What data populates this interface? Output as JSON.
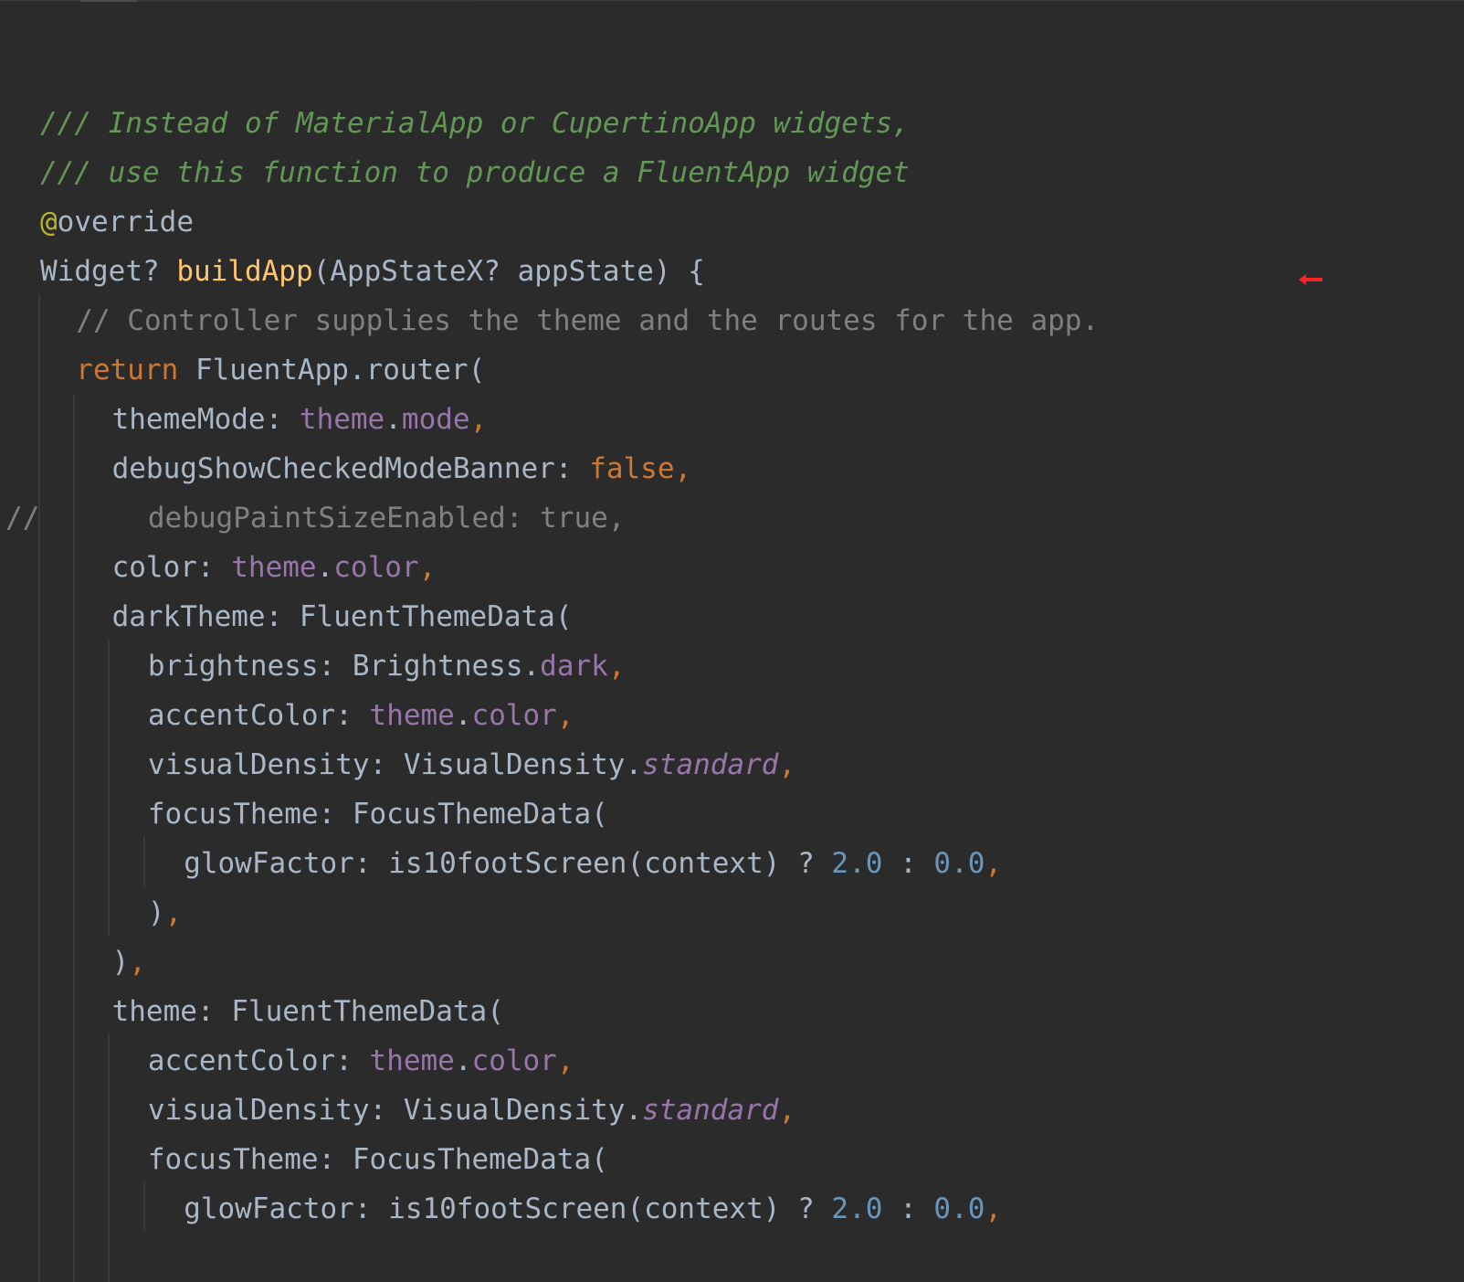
{
  "lines": [
    {
      "marker": "",
      "indent": 0,
      "segments": [
        {
          "text": "/// Instead of MaterialApp or CupertinoApp widgets,",
          "cls": "c-doc"
        }
      ]
    },
    {
      "marker": "",
      "indent": 0,
      "segments": [
        {
          "text": "/// use this function to produce a FluentApp widget",
          "cls": "c-doc"
        }
      ]
    },
    {
      "marker": "",
      "indent": 0,
      "segments": [
        {
          "text": "@",
          "cls": "c-anno"
        },
        {
          "text": "override",
          "cls": "c-default"
        }
      ]
    },
    {
      "marker": "",
      "indent": 0,
      "segments": [
        {
          "text": "Widget? ",
          "cls": "c-default"
        },
        {
          "text": "buildApp",
          "cls": "c-func"
        },
        {
          "text": "(AppStateX? appState) {",
          "cls": "c-default"
        }
      ]
    },
    {
      "marker": "",
      "indent": 1,
      "segments": [
        {
          "text": "// Controller supplies the theme and the routes for the app.",
          "cls": "c-comment"
        }
      ]
    },
    {
      "marker": "",
      "indent": 1,
      "segments": [
        {
          "text": "return ",
          "cls": "c-keyword"
        },
        {
          "text": "FluentApp.router(",
          "cls": "c-default"
        }
      ]
    },
    {
      "marker": "",
      "indent": 2,
      "segments": [
        {
          "text": "themeMode: ",
          "cls": "c-default"
        },
        {
          "text": "theme",
          "cls": "c-field"
        },
        {
          "text": ".",
          "cls": "c-default"
        },
        {
          "text": "mode",
          "cls": "c-field"
        },
        {
          "text": ",",
          "cls": "c-comma"
        }
      ]
    },
    {
      "marker": "",
      "indent": 2,
      "segments": [
        {
          "text": "debugShowCheckedModeBanner: ",
          "cls": "c-default"
        },
        {
          "text": "false",
          "cls": "c-keyword"
        },
        {
          "text": ",",
          "cls": "c-comma"
        }
      ]
    },
    {
      "marker": "//",
      "indent": 3,
      "segments": [
        {
          "text": "debugPaintSizeEnabled: true,",
          "cls": "c-muted"
        }
      ]
    },
    {
      "marker": "",
      "indent": 2,
      "segments": [
        {
          "text": "color: ",
          "cls": "c-default"
        },
        {
          "text": "theme",
          "cls": "c-field"
        },
        {
          "text": ".",
          "cls": "c-default"
        },
        {
          "text": "color",
          "cls": "c-field"
        },
        {
          "text": ",",
          "cls": "c-comma"
        }
      ]
    },
    {
      "marker": "",
      "indent": 2,
      "segments": [
        {
          "text": "darkTheme: FluentThemeData(",
          "cls": "c-default"
        }
      ]
    },
    {
      "marker": "",
      "indent": 3,
      "segments": [
        {
          "text": "brightness: Brightness.",
          "cls": "c-default"
        },
        {
          "text": "dark",
          "cls": "c-field"
        },
        {
          "text": ",",
          "cls": "c-comma"
        }
      ]
    },
    {
      "marker": "",
      "indent": 3,
      "segments": [
        {
          "text": "accentColor: ",
          "cls": "c-default"
        },
        {
          "text": "theme",
          "cls": "c-field"
        },
        {
          "text": ".",
          "cls": "c-default"
        },
        {
          "text": "color",
          "cls": "c-field"
        },
        {
          "text": ",",
          "cls": "c-comma"
        }
      ]
    },
    {
      "marker": "",
      "indent": 3,
      "segments": [
        {
          "text": "visualDensity: VisualDensity.",
          "cls": "c-default"
        },
        {
          "text": "standard",
          "cls": "c-static"
        },
        {
          "text": ",",
          "cls": "c-comma"
        }
      ]
    },
    {
      "marker": "",
      "indent": 3,
      "segments": [
        {
          "text": "focusTheme: FocusThemeData(",
          "cls": "c-default"
        }
      ]
    },
    {
      "marker": "",
      "indent": 4,
      "segments": [
        {
          "text": "glowFactor: is10footScreen(context) ? ",
          "cls": "c-default"
        },
        {
          "text": "2.0",
          "cls": "c-number"
        },
        {
          "text": " : ",
          "cls": "c-default"
        },
        {
          "text": "0.0",
          "cls": "c-number"
        },
        {
          "text": ",",
          "cls": "c-comma"
        }
      ]
    },
    {
      "marker": "",
      "indent": 3,
      "segments": [
        {
          "text": ")",
          "cls": "c-default"
        },
        {
          "text": ",",
          "cls": "c-comma"
        }
      ]
    },
    {
      "marker": "",
      "indent": 2,
      "segments": [
        {
          "text": ")",
          "cls": "c-default"
        },
        {
          "text": ",",
          "cls": "c-comma"
        }
      ]
    },
    {
      "marker": "",
      "indent": 2,
      "segments": [
        {
          "text": "theme: FluentThemeData(",
          "cls": "c-default"
        }
      ]
    },
    {
      "marker": "",
      "indent": 3,
      "segments": [
        {
          "text": "accentColor: ",
          "cls": "c-default"
        },
        {
          "text": "theme",
          "cls": "c-field"
        },
        {
          "text": ".",
          "cls": "c-default"
        },
        {
          "text": "color",
          "cls": "c-field"
        },
        {
          "text": ",",
          "cls": "c-comma"
        }
      ]
    },
    {
      "marker": "",
      "indent": 3,
      "segments": [
        {
          "text": "visualDensity: VisualDensity.",
          "cls": "c-default"
        },
        {
          "text": "standard",
          "cls": "c-static"
        },
        {
          "text": ",",
          "cls": "c-comma"
        }
      ]
    },
    {
      "marker": "",
      "indent": 3,
      "segments": [
        {
          "text": "focusTheme: FocusThemeData(",
          "cls": "c-default"
        }
      ]
    },
    {
      "marker": "",
      "indent": 4,
      "segments": [
        {
          "text": "glowFactor: is10footScreen(context) ? ",
          "cls": "c-default"
        },
        {
          "text": "2.0",
          "cls": "c-number"
        },
        {
          "text": " : ",
          "cls": "c-default"
        },
        {
          "text": "0.0",
          "cls": "c-number"
        },
        {
          "text": ",",
          "cls": "c-comma"
        }
      ]
    }
  ],
  "colors": {
    "background": "#2b2b2b",
    "doc_comment": "#629755",
    "comment": "#808080",
    "annotation": "#bbb529",
    "default": "#a9b7c6",
    "function": "#ffc66d",
    "keyword": "#cc7832",
    "field": "#9876aa",
    "number": "#6897bb",
    "marker_arrow": "#ff2020"
  },
  "icons": {
    "bookmark_arrow": "left-arrow-icon"
  }
}
